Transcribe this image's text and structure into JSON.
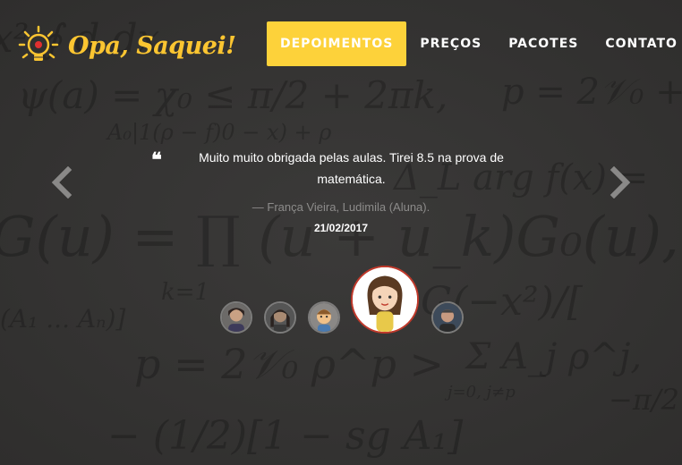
{
  "brand": {
    "name": "Opa, Saquei!",
    "accent_color": "#fdd23a",
    "logo_icon": "lightbulb-icon"
  },
  "nav": {
    "items": [
      {
        "label": "DEPOIMENTOS",
        "active": true
      },
      {
        "label": "PREÇOS",
        "active": false
      },
      {
        "label": "PACOTES",
        "active": false
      },
      {
        "label": "CONTATO",
        "active": false
      }
    ]
  },
  "carousel": {
    "prev_icon": "chevron-left-icon",
    "next_icon": "chevron-right-icon",
    "quote_icon": "quote-icon",
    "quote_mark": "❝",
    "testimonial": {
      "text": "Muito muito obrigada pelas aulas. Tirei 8.5 na prova de matemática.",
      "author": "— França Vieira, Ludimila (Aluna).",
      "date": "21/02/2017"
    },
    "avatars": [
      {
        "name": "avatar-student-1",
        "active": false
      },
      {
        "name": "avatar-student-2",
        "active": false
      },
      {
        "name": "avatar-student-3",
        "active": false
      },
      {
        "name": "avatar-ludimila",
        "active": true
      },
      {
        "name": "avatar-student-5",
        "active": false
      }
    ]
  }
}
